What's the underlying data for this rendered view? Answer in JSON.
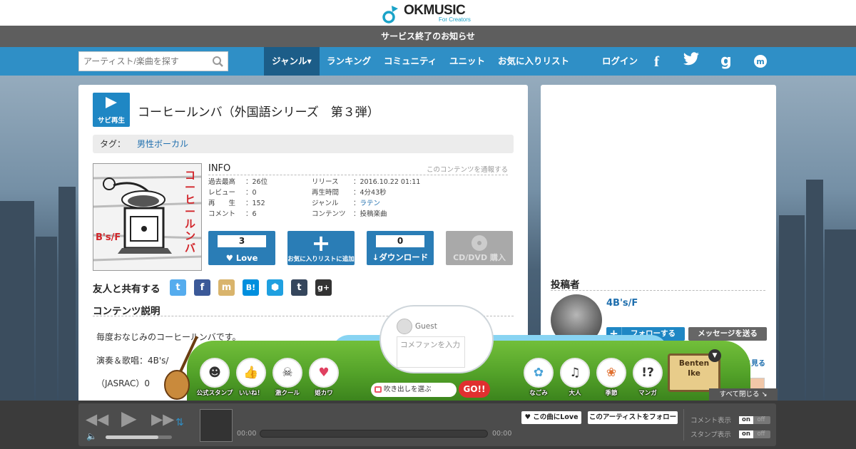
{
  "header": {
    "logo_text": "OKMUSIC",
    "logo_sub": "For Creators",
    "notice": "サービス終了のお知らせ"
  },
  "nav": {
    "search_placeholder": "アーティスト/楽曲を探す",
    "items": [
      "ジャンル▾",
      "ランキング",
      "コミュニティ",
      "ユニット",
      "お気に入りリスト"
    ],
    "login": "ログイン",
    "social": [
      "f",
      "twitter",
      "g",
      "m"
    ]
  },
  "song": {
    "sabi_label": "サビ再生",
    "title": "コーヒールンバ（外国語シリーズ　第３弾）",
    "tag_label": "タグ：",
    "tag": "男性ボーカル",
    "jacket_text": "コーヒールンバ",
    "jacket_artist": "B's/F",
    "info_title": "INFO",
    "report": "このコンテンツを通報する",
    "info_left": [
      {
        "k": "過去最高",
        "v": "：26位"
      },
      {
        "k": "レビュー",
        "v": "：0"
      },
      {
        "k": "再　　生",
        "v": "：152"
      },
      {
        "k": "コメント",
        "v": "：6"
      }
    ],
    "info_right": [
      {
        "k": "リリース",
        "v": "：2016.10.22 01:11",
        "link": false
      },
      {
        "k": "再生時間",
        "v": "：4分43秒",
        "link": false
      },
      {
        "k": "ジャンル",
        "v": "：",
        "lv": "ラテン",
        "link": true
      },
      {
        "k": "コンテンツ",
        "v": "：投稿楽曲",
        "link": false
      }
    ],
    "buttons": {
      "love_count": "3",
      "love_label": "Love",
      "fav_label": "お気に入りリストに追加",
      "dl_count": "0",
      "dl_label": "ダウンロード",
      "cd_label": "CD/DVD 購入"
    },
    "share_title": "友人と共有する",
    "share_icons": [
      "twitter",
      "facebook",
      "mixi",
      "hatena",
      "hex",
      "tumblr",
      "google-plus"
    ],
    "desc_title": "コンテンツ説明",
    "desc_lines": [
      "毎度おなじみのコーヒールンバです。",
      "演奏＆歌唱：4B's/",
      "（JASRAC）0"
    ]
  },
  "poster": {
    "title": "投稿者",
    "name": "4B's/F",
    "follow": "フォローする",
    "message": "メッセージを送る",
    "more": "もっと見る"
  },
  "stamps": {
    "guest": "Guest",
    "comment_placeholder": "コメファンを入力",
    "labels": [
      "公式スタンプ",
      "いいね！",
      "激クール",
      "姫カワ",
      "なごみ",
      "大人",
      "季節",
      "マンガ"
    ],
    "choose": "吹き出しを選ぶ",
    "go": "GO!!",
    "benten": "Benten Ike",
    "close_all": "すべて閉じる"
  },
  "player": {
    "time_start": "00:00",
    "time_end": "00:00",
    "love_btn": "この曲にLove",
    "follow_btn": "このアーティストをフォロー",
    "comment_toggle": "コメント表示",
    "stamp_toggle": "スタンプ表示",
    "on": "on",
    "off": "off",
    "volume": 0.8
  }
}
